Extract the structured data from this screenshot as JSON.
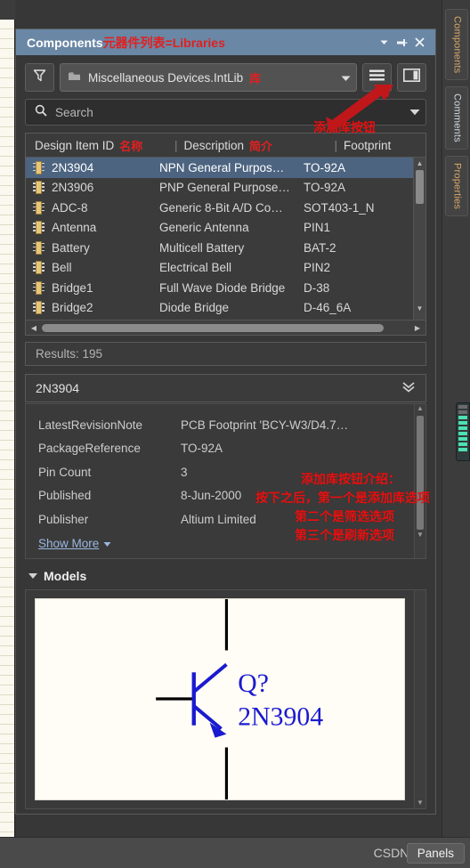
{
  "panel": {
    "title_en": "Components",
    "title_cn": "元器件列表=Libraries",
    "title_buttons": {
      "dropdown": "dropdown-arrow",
      "pin": "pin-icon",
      "close": "close-icon"
    }
  },
  "toolbar": {
    "filter_icon": "funnel-filter-icon",
    "library_value": "Miscellaneous Devices.IntLib",
    "library_cn_label": "库",
    "library_icon": "library-folder-icon",
    "menu_button": "hamburger-menu-icon",
    "split_button": "panel-split-icon"
  },
  "search": {
    "placeholder": "Search",
    "value": "",
    "icon": "search-icon",
    "expand_icon": "chevron-down-icon"
  },
  "table": {
    "headers": [
      {
        "label": "Design Item ID",
        "cn": "名称"
      },
      {
        "label": "Description",
        "cn": "简介"
      },
      {
        "label": "Footprint",
        "cn": ""
      }
    ],
    "rows": [
      {
        "id": "2N3904",
        "desc": "NPN General Purpos…",
        "footprint": "TO-92A",
        "selected": true
      },
      {
        "id": "2N3906",
        "desc": "PNP General Purpose…",
        "footprint": "TO-92A",
        "selected": false
      },
      {
        "id": "ADC-8",
        "desc": "Generic 8-Bit A/D Co…",
        "footprint": "SOT403-1_N",
        "selected": false
      },
      {
        "id": "Antenna",
        "desc": "Generic Antenna",
        "footprint": "PIN1",
        "selected": false
      },
      {
        "id": "Battery",
        "desc": "Multicell Battery",
        "footprint": "BAT-2",
        "selected": false
      },
      {
        "id": "Bell",
        "desc": "Electrical Bell",
        "footprint": "PIN2",
        "selected": false
      },
      {
        "id": "Bridge1",
        "desc": "Full Wave Diode Bridge",
        "footprint": "D-38",
        "selected": false
      },
      {
        "id": "Bridge2",
        "desc": "Diode Bridge",
        "footprint": "D-46_6A",
        "selected": false
      }
    ]
  },
  "results": {
    "text": "Results: 195"
  },
  "detail": {
    "header": "2N3904",
    "collapse_icon": "double-chevron-down-icon",
    "properties": [
      {
        "key": "LatestRevisionNote",
        "value": "PCB Footprint 'BCY-W3/D4.7…"
      },
      {
        "key": "PackageReference",
        "value": "TO-92A"
      },
      {
        "key": "Pin Count",
        "value": "3"
      },
      {
        "key": "Published",
        "value": "8-Jun-2000"
      },
      {
        "key": "Publisher",
        "value": "Altium Limited"
      }
    ],
    "show_more": "Show More"
  },
  "models": {
    "header": "Models",
    "symbol": {
      "designator": "Q?",
      "part_number": "2N3904",
      "color": "#1a1ad0",
      "wire_color": "#000000"
    }
  },
  "statusbar": {
    "watermark": "CSDN @An_m",
    "panels_button": "Panels"
  },
  "right_dock": {
    "tabs": [
      {
        "label": "Components",
        "state": "orange"
      },
      {
        "label": "Comments",
        "state": "active"
      },
      {
        "label": "Properties",
        "state": "orange"
      }
    ]
  },
  "annotations": {
    "add_library_button": "添加库按钮",
    "intro_line1": "添加库按钮介绍：",
    "intro_line2": "按下之后，第一个是添加库选项",
    "intro_line3": "第二个是筛选选项",
    "intro_line4": "第三个是刷新选项",
    "arrow_color": "#c0171b"
  }
}
